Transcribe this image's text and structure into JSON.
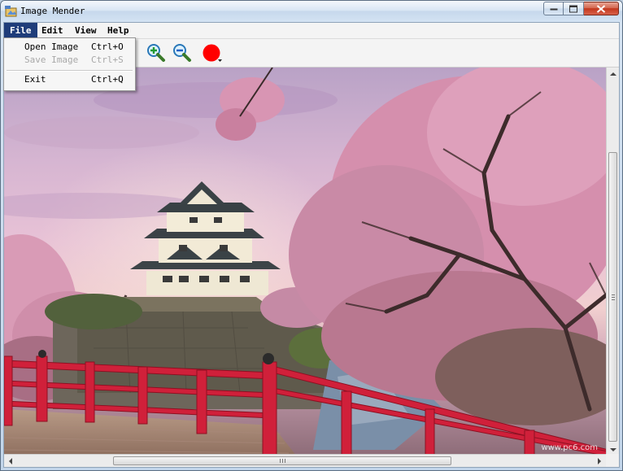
{
  "window": {
    "title": "Image Mender"
  },
  "menubar": {
    "items": [
      "File",
      "Edit",
      "View",
      "Help"
    ],
    "open": "File"
  },
  "file_menu": {
    "items": [
      {
        "label": "Open Image",
        "shortcut": "Ctrl+O",
        "enabled": true
      },
      {
        "label": "Save Image",
        "shortcut": "Ctrl+S",
        "enabled": false
      },
      {
        "label": "Exit",
        "shortcut": "Ctrl+Q",
        "enabled": true
      }
    ]
  },
  "toolbar": {
    "tools": [
      "zoom-in-icon",
      "zoom-out-icon",
      "brush-color-picker"
    ],
    "brush_color": "#ff0000"
  },
  "image": {
    "subject": "castle-with-cherry-blossoms",
    "watermark": "www.pc6.com"
  },
  "colors": {
    "menu_highlight": "#1f3d7a",
    "bridge_red": "#d0203a"
  }
}
